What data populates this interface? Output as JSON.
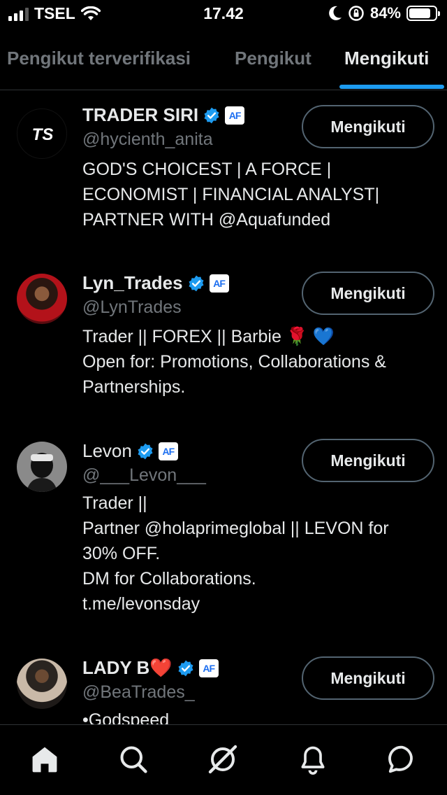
{
  "status_bar": {
    "carrier": "TSEL",
    "time": "17.42",
    "battery": "84%",
    "battery_level": 0.84
  },
  "tabs": [
    {
      "label": "Pengikut terverifikasi",
      "active": false
    },
    {
      "label": "Pengikut",
      "active": false
    },
    {
      "label": "Mengikuti",
      "active": true
    }
  ],
  "users": [
    {
      "name": "TRADER SIRI",
      "handle": "@hycienth_anita",
      "bio": [
        "GOD'S CHOICEST | A FORCE |",
        "ECONOMIST | FINANCIAL ANALYST|",
        "PARTNER WITH @Aquafunded"
      ],
      "button": "Mengikuti",
      "avatar_text": "TS",
      "verified": true,
      "affiliate_badge": "AF"
    },
    {
      "name": "Lyn_Trades",
      "handle": "@LynTrades",
      "bio": [
        "Trader || FOREX || Barbie 🌹 💙",
        "Open for: Promotions, Collaborations &",
        "Partnerships."
      ],
      "button": "Mengikuti",
      "verified": true,
      "affiliate_badge": "AF"
    },
    {
      "name": "Levon",
      "handle": "@___Levon___",
      "bio": [
        "Trader ||",
        "Partner @holaprimeglobal || LEVON for",
        "30% OFF.",
        "DM for Collaborations.",
        "t.me/levonsday"
      ],
      "button": "Mengikuti",
      "verified": true,
      "affiliate_badge": "AF"
    },
    {
      "name": "LADY B❤️",
      "handle": "@BeaTrades_",
      "bio": [
        "•Godspeed"
      ],
      "button": "Mengikuti",
      "verified": true,
      "affiliate_badge": "AF"
    }
  ],
  "bottom_nav": [
    {
      "icon": "home-icon",
      "active": true
    },
    {
      "icon": "search-icon",
      "active": false
    },
    {
      "icon": "grok-icon",
      "active": false
    },
    {
      "icon": "bell-icon",
      "active": false
    },
    {
      "icon": "chat-bubble-icon",
      "active": false
    }
  ]
}
